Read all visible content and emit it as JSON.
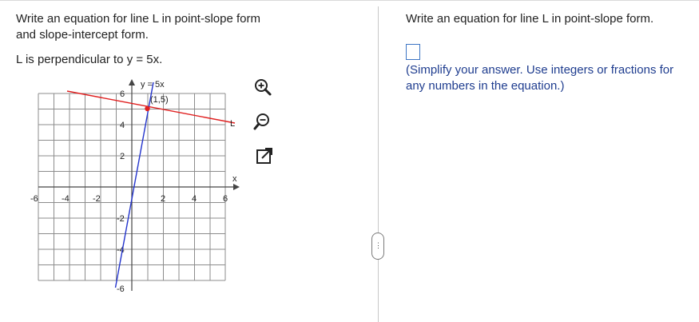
{
  "question": {
    "line1": "Write an equation for line L in point-slope form",
    "line2": "and slope-intercept form.",
    "condition": "L is perpendicular to y = 5x."
  },
  "graph": {
    "curve_label": "y = 5x",
    "point_label": "(1,5)",
    "line_label": "L",
    "x_axis_label": "x",
    "x_ticks": [
      "-6",
      "-4",
      "-2",
      "2",
      "4",
      "6"
    ],
    "y_ticks": [
      "6",
      "4",
      "2",
      "-2",
      "-4",
      "-6"
    ],
    "blue_color": "#2233cc",
    "red_color": "#e02020"
  },
  "tools": {
    "zoom_in": "zoom-in-icon",
    "zoom_out": "zoom-out-icon",
    "popout": "popout-icon"
  },
  "answer_panel": {
    "title": "Write an equation for line L in point-slope form.",
    "hint": "(Simplify your answer. Use integers or fractions for any numbers in the equation.)"
  },
  "divider_handle": "⋮"
}
